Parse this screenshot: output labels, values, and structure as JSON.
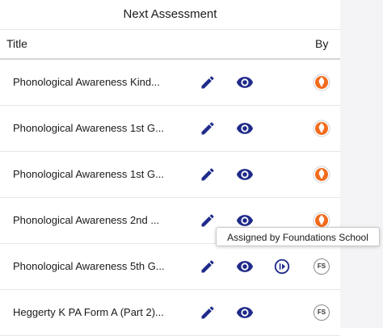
{
  "panel": {
    "title": "Next Assessment"
  },
  "table": {
    "columns": {
      "title": "Title",
      "by": "By"
    },
    "rows": [
      {
        "title": "Phonological Awareness Kind...",
        "by": "school-logo",
        "actions": [
          "edit",
          "view"
        ]
      },
      {
        "title": "Phonological Awareness 1st G...",
        "by": "school-logo",
        "actions": [
          "edit",
          "view"
        ]
      },
      {
        "title": "Phonological Awareness 1st G...",
        "by": "school-logo",
        "actions": [
          "edit",
          "view"
        ]
      },
      {
        "title": "Phonological Awareness 2nd ...",
        "by": "school-logo",
        "actions": [
          "edit",
          "view"
        ]
      },
      {
        "title": "Phonological Awareness 5th G...",
        "by": "FS",
        "actions": [
          "edit",
          "view",
          "play"
        ]
      },
      {
        "title": "Heggerty K PA Form A (Part 2)...",
        "by": "FS",
        "actions": [
          "edit",
          "view"
        ]
      }
    ]
  },
  "tooltip": {
    "text": "Assigned by Foundations School"
  },
  "colors": {
    "icon": "#1f2a8a",
    "logo": "#f26b1d",
    "border": "#e6e6e6",
    "side_panel": "#f4f4f6"
  },
  "icons": {
    "edit": "pencil-icon",
    "view": "eye-icon",
    "play": "play-circle-icon",
    "logo": "flame-logo-icon"
  }
}
